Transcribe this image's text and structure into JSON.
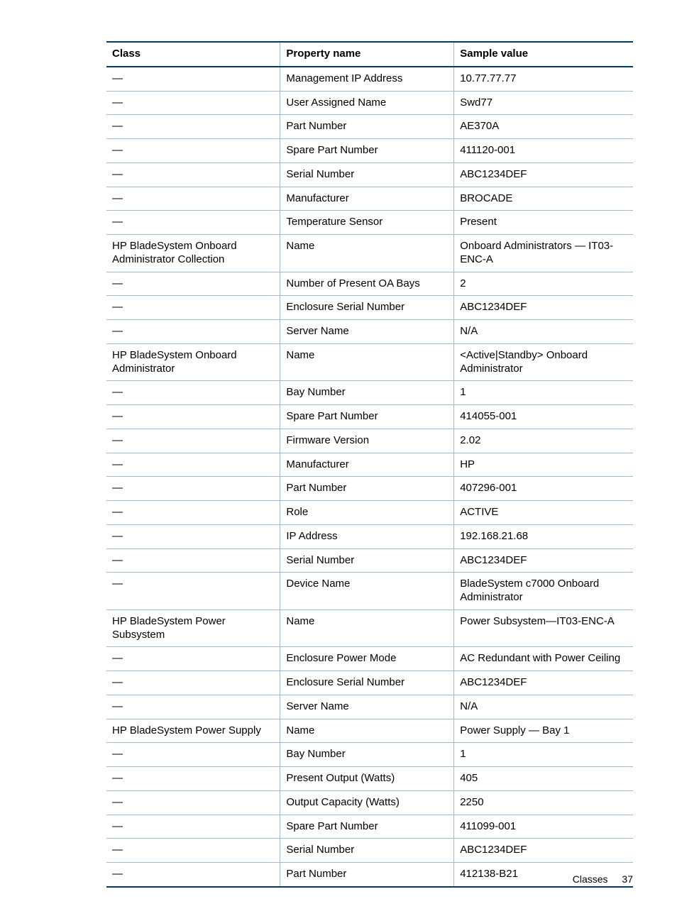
{
  "table": {
    "headers": {
      "class": "Class",
      "property": "Property name",
      "value": "Sample value"
    },
    "rows": [
      {
        "class": "—",
        "property": "Management IP Address",
        "value": "10.77.77.77"
      },
      {
        "class": "—",
        "property": "User Assigned Name",
        "value": "Swd77"
      },
      {
        "class": "—",
        "property": "Part Number",
        "value": "AE370A"
      },
      {
        "class": "—",
        "property": "Spare Part Number",
        "value": "411120-001"
      },
      {
        "class": "—",
        "property": "Serial Number",
        "value": "ABC1234DEF"
      },
      {
        "class": "—",
        "property": "Manufacturer",
        "value": "BROCADE"
      },
      {
        "class": "—",
        "property": "Temperature Sensor",
        "value": "Present"
      },
      {
        "class": "HP BladeSystem Onboard Administrator Collection",
        "property": "Name",
        "value": "Onboard Administrators — IT03-ENC-A"
      },
      {
        "class": "—",
        "property": "Number of Present OA Bays",
        "value": "2"
      },
      {
        "class": "—",
        "property": "Enclosure Serial Number",
        "value": "ABC1234DEF"
      },
      {
        "class": "—",
        "property": "Server Name",
        "value": "N/A"
      },
      {
        "class": "HP BladeSystem Onboard Administrator",
        "property": "Name",
        "value": "<Active|Standby> Onboard Administrator"
      },
      {
        "class": "—",
        "property": "Bay Number",
        "value": "1"
      },
      {
        "class": "—",
        "property": "Spare Part Number",
        "value": "414055-001"
      },
      {
        "class": "—",
        "property": "Firmware Version",
        "value": "2.02"
      },
      {
        "class": "—",
        "property": "Manufacturer",
        "value": "HP"
      },
      {
        "class": "—",
        "property": "Part Number",
        "value": "407296-001"
      },
      {
        "class": "—",
        "property": "Role",
        "value": "ACTIVE"
      },
      {
        "class": "—",
        "property": "IP Address",
        "value": "192.168.21.68"
      },
      {
        "class": "—",
        "property": "Serial Number",
        "value": "ABC1234DEF"
      },
      {
        "class": "—",
        "property": "Device Name",
        "value": "BladeSystem c7000 Onboard Administrator"
      },
      {
        "class": "HP BladeSystem Power Subsystem",
        "property": "Name",
        "value": "Power Subsystem—IT03-ENC-A"
      },
      {
        "class": "—",
        "property": "Enclosure Power Mode",
        "value": "AC Redundant with Power Ceiling"
      },
      {
        "class": "—",
        "property": "Enclosure Serial Number",
        "value": "ABC1234DEF"
      },
      {
        "class": "—",
        "property": "Server Name",
        "value": "N/A"
      },
      {
        "class": "HP BladeSystem Power Supply",
        "property": "Name",
        "value": "Power Supply — Bay 1"
      },
      {
        "class": "—",
        "property": "Bay Number",
        "value": "1"
      },
      {
        "class": "—",
        "property": "Present Output (Watts)",
        "value": "405"
      },
      {
        "class": "—",
        "property": "Output Capacity (Watts)",
        "value": "2250"
      },
      {
        "class": "—",
        "property": "Spare Part Number",
        "value": "411099-001"
      },
      {
        "class": "—",
        "property": "Serial Number",
        "value": "ABC1234DEF"
      },
      {
        "class": "—",
        "property": "Part Number",
        "value": "412138-B21"
      }
    ]
  },
  "footer": {
    "section": "Classes",
    "page": "37"
  }
}
